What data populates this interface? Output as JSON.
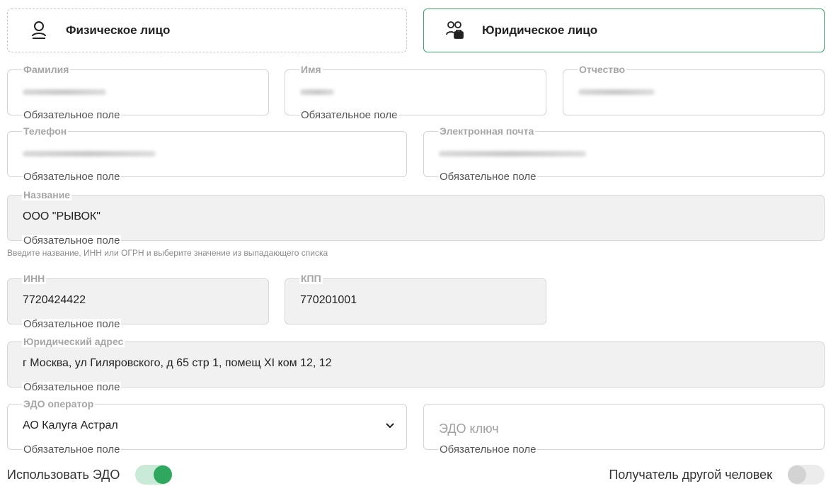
{
  "client_types": {
    "person": {
      "label": "Физическое лицо",
      "icon": "user-icon"
    },
    "company": {
      "label": "Юридическое лицо",
      "icon": "users-briefcase-icon",
      "selected": true
    }
  },
  "required_note": "Обязательное поле",
  "fields": {
    "last_name": {
      "label": "Фамилия"
    },
    "first_name": {
      "label": "Имя"
    },
    "middle_name": {
      "label": "Отчество"
    },
    "phone": {
      "label": "Телефон"
    },
    "email": {
      "label": "Электронная почта"
    },
    "company_name": {
      "label": "Название",
      "value": "ООО \"РЫВОК\"",
      "hint": "Введите название, ИНН или ОГРН и выберите значение из выпадающего списка"
    },
    "inn": {
      "label": "ИНН",
      "value": "7720424422"
    },
    "kpp": {
      "label": "КПП",
      "value": "770201001"
    },
    "legal_address": {
      "label": "Юридический адрес",
      "value": "г Москва, ул Гиляровского, д 65 стр 1, помещ XI ком 12, 12"
    },
    "edo_operator": {
      "label": "ЭДО оператор",
      "value": "АО Калуга Астрал"
    },
    "edo_key": {
      "placeholder": "ЭДО ключ"
    }
  },
  "toggles": {
    "use_edo": {
      "label": "Использовать ЭДО",
      "on": true
    },
    "other_recipient": {
      "label": "Получатель другой человек",
      "on": false
    }
  },
  "colors": {
    "accent": "#2fa75f",
    "border_selected": "#3aa668"
  }
}
